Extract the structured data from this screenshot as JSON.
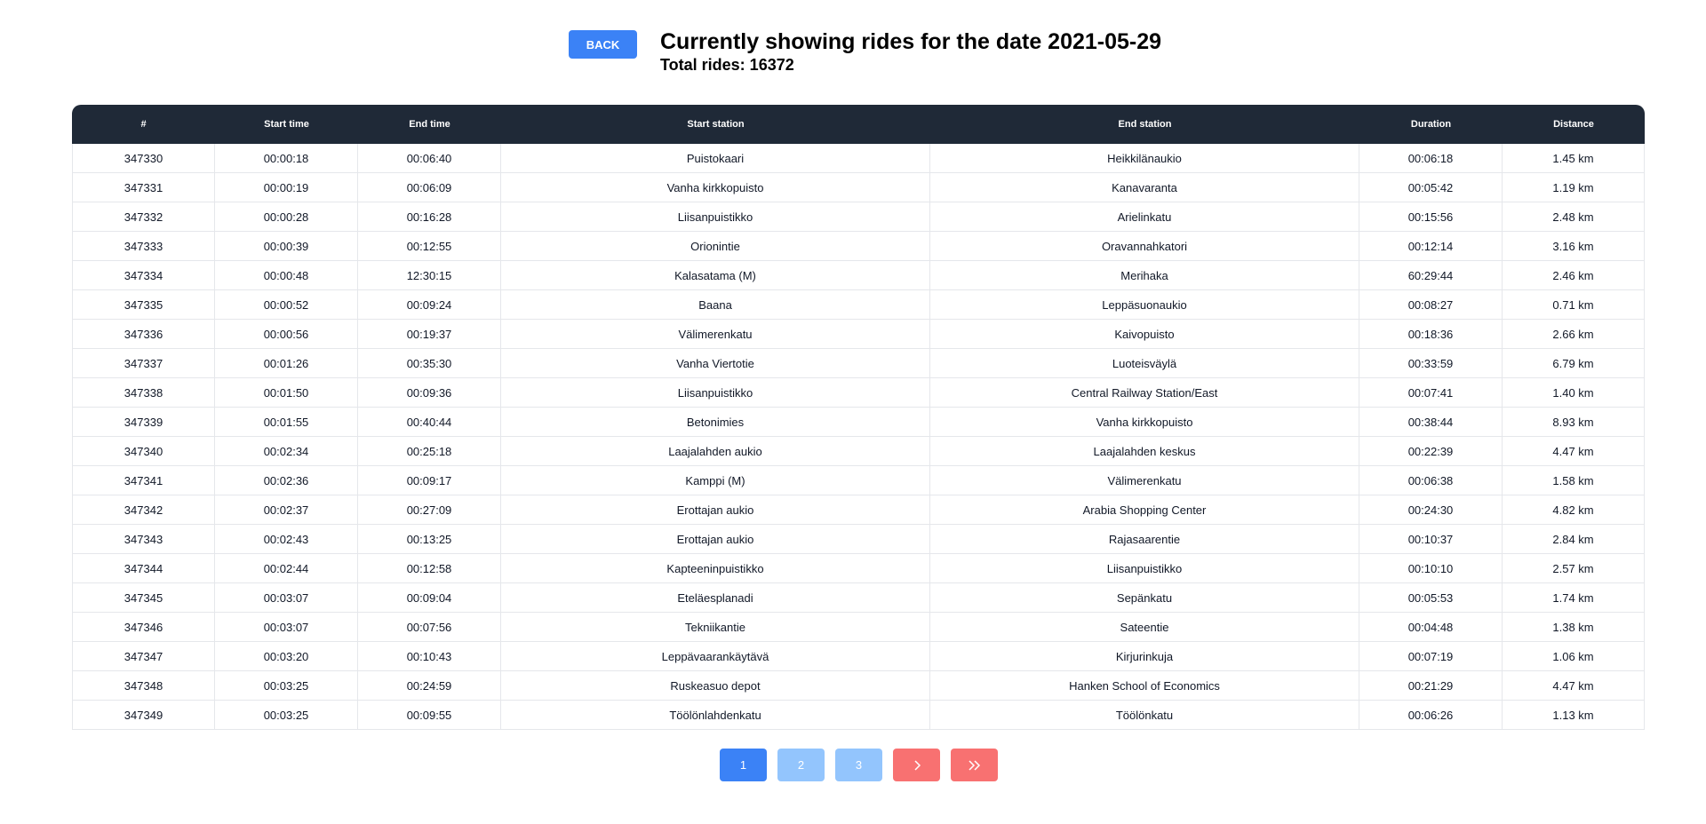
{
  "header": {
    "back_label": "BACK",
    "title": "Currently showing rides for the date 2021-05-29",
    "total": "Total rides: 16372"
  },
  "table": {
    "columns": [
      "#",
      "Start time",
      "End time",
      "Start station",
      "End station",
      "Duration",
      "Distance"
    ],
    "rows": [
      [
        "347330",
        "00:00:18",
        "00:06:40",
        "Puistokaari",
        "Heikkilänaukio",
        "00:06:18",
        "1.45 km"
      ],
      [
        "347331",
        "00:00:19",
        "00:06:09",
        "Vanha kirkkopuisto",
        "Kanavaranta",
        "00:05:42",
        "1.19 km"
      ],
      [
        "347332",
        "00:00:28",
        "00:16:28",
        "Liisanpuistikko",
        "Arielinkatu",
        "00:15:56",
        "2.48 km"
      ],
      [
        "347333",
        "00:00:39",
        "00:12:55",
        "Orionintie",
        "Oravannahkatori",
        "00:12:14",
        "3.16 km"
      ],
      [
        "347334",
        "00:00:48",
        "12:30:15",
        "Kalasatama (M)",
        "Merihaka",
        "60:29:44",
        "2.46 km"
      ],
      [
        "347335",
        "00:00:52",
        "00:09:24",
        "Baana",
        "Leppäsuonaukio",
        "00:08:27",
        "0.71 km"
      ],
      [
        "347336",
        "00:00:56",
        "00:19:37",
        "Välimerenkatu",
        "Kaivopuisto",
        "00:18:36",
        "2.66 km"
      ],
      [
        "347337",
        "00:01:26",
        "00:35:30",
        "Vanha Viertotie",
        "Luoteisväylä",
        "00:33:59",
        "6.79 km"
      ],
      [
        "347338",
        "00:01:50",
        "00:09:36",
        "Liisanpuistikko",
        "Central Railway Station/East",
        "00:07:41",
        "1.40 km"
      ],
      [
        "347339",
        "00:01:55",
        "00:40:44",
        "Betonimies",
        "Vanha kirkkopuisto",
        "00:38:44",
        "8.93 km"
      ],
      [
        "347340",
        "00:02:34",
        "00:25:18",
        "Laajalahden aukio",
        "Laajalahden keskus",
        "00:22:39",
        "4.47 km"
      ],
      [
        "347341",
        "00:02:36",
        "00:09:17",
        "Kamppi (M)",
        "Välimerenkatu",
        "00:06:38",
        "1.58 km"
      ],
      [
        "347342",
        "00:02:37",
        "00:27:09",
        "Erottajan aukio",
        "Arabia Shopping Center",
        "00:24:30",
        "4.82 km"
      ],
      [
        "347343",
        "00:02:43",
        "00:13:25",
        "Erottajan aukio",
        "Rajasaarentie",
        "00:10:37",
        "2.84 km"
      ],
      [
        "347344",
        "00:02:44",
        "00:12:58",
        "Kapteeninpuistikko",
        "Liisanpuistikko",
        "00:10:10",
        "2.57 km"
      ],
      [
        "347345",
        "00:03:07",
        "00:09:04",
        "Eteläesplanadi",
        "Sepänkatu",
        "00:05:53",
        "1.74 km"
      ],
      [
        "347346",
        "00:03:07",
        "00:07:56",
        "Tekniikantie",
        "Sateentie",
        "00:04:48",
        "1.38 km"
      ],
      [
        "347347",
        "00:03:20",
        "00:10:43",
        "Leppävaarankäytävä",
        "Kirjurinkuja",
        "00:07:19",
        "1.06 km"
      ],
      [
        "347348",
        "00:03:25",
        "00:24:59",
        "Ruskeasuo depot",
        "Hanken School of Economics",
        "00:21:29",
        "4.47 km"
      ],
      [
        "347349",
        "00:03:25",
        "00:09:55",
        "Töölönlahdenkatu",
        "Töölönkatu",
        "00:06:26",
        "1.13 km"
      ]
    ]
  },
  "pagination": {
    "pages": [
      "1",
      "2",
      "3"
    ],
    "current_page": "1",
    "next_icon": "chevron-right-icon",
    "last_icon": "double-chevron-right-icon"
  },
  "colors": {
    "accent": "#3b82f6",
    "accent_light": "#93c5fd",
    "nav_red": "#f87171",
    "table_header": "#1f2937"
  }
}
